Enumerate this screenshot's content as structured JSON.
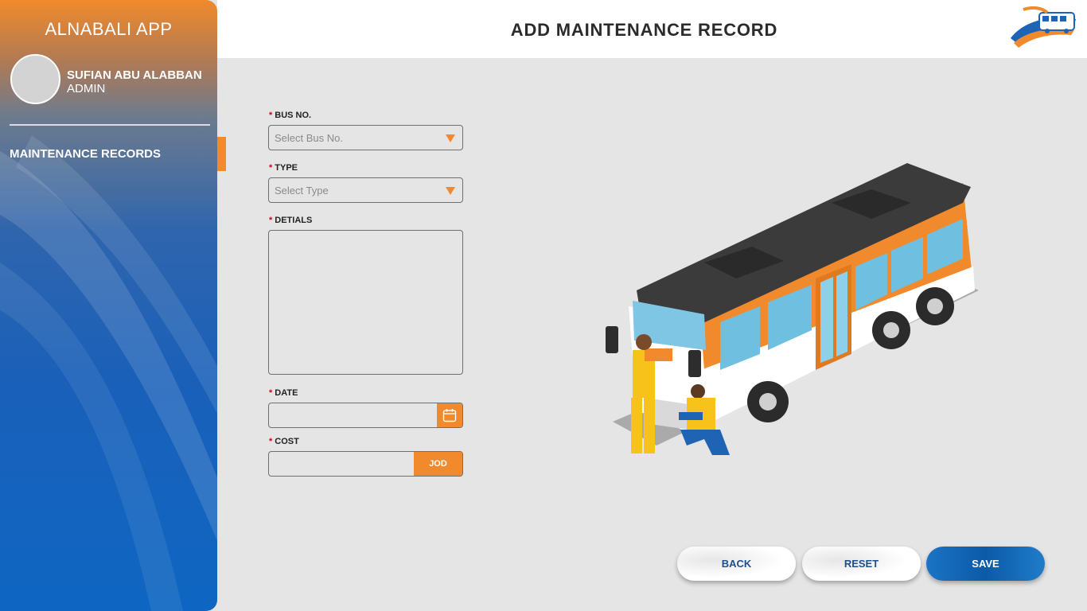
{
  "sidebar": {
    "app_title": "ALNABALI APP",
    "user_name": "SUFIAN ABU ALABBAN",
    "user_role": "ADMIN",
    "nav_items": [
      {
        "label": "MAINTENANCE RECORDS",
        "active": true
      }
    ]
  },
  "header": {
    "title": "ADD MAINTENANCE RECORD",
    "logo_icon": "bus-logo-icon"
  },
  "form": {
    "required_mark": "*",
    "bus_no": {
      "label": "BUS NO.",
      "placeholder": "Select Bus No.",
      "value": ""
    },
    "type": {
      "label": "TYPE",
      "placeholder": "Select Type",
      "value": ""
    },
    "details": {
      "label": "DETIALS",
      "value": ""
    },
    "date": {
      "label": "DATE",
      "value": "",
      "icon": "calendar-icon"
    },
    "cost": {
      "label": "COST",
      "value": "",
      "currency": "JOD"
    }
  },
  "actions": {
    "back": "BACK",
    "reset": "RESET",
    "save": "SAVE"
  },
  "colors": {
    "accent": "#f08a2c",
    "primary": "#0e66c2",
    "background": "#e5e5e5"
  }
}
